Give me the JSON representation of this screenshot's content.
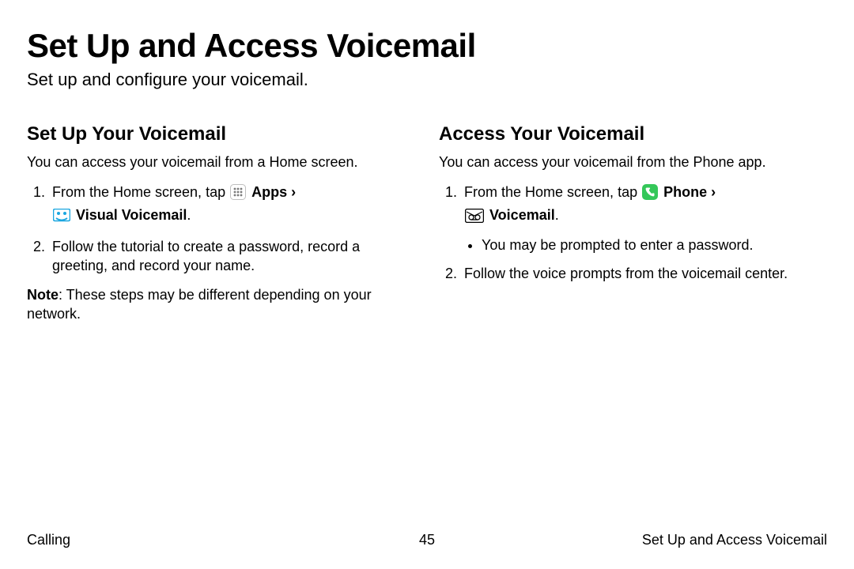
{
  "title": "Set Up and Access Voicemail",
  "subtitle": "Set up and configure your voicemail.",
  "left": {
    "heading": "Set Up Your Voicemail",
    "intro": "You can access your voicemail from a Home screen.",
    "step1_prefix": "From the Home screen, tap ",
    "apps_label": "Apps",
    "sep": "›",
    "visual_vm_label": "Visual Voicemail",
    "period": ".",
    "step2": "Follow the tutorial to create a password, record a greeting, and record your name.",
    "note_label": "Note",
    "note_body": ": These steps may be different depending on your network."
  },
  "right": {
    "heading": "Access Your Voicemail",
    "intro": "You can access your voicemail from the Phone app.",
    "step1_prefix": "From the Home screen, tap ",
    "phone_label": "Phone",
    "sep": "›",
    "vm_label": "Voicemail",
    "period": ".",
    "bullet1": "You may be prompted to enter a password.",
    "step2": "Follow the voice prompts from the voicemail center."
  },
  "footer": {
    "left": "Calling",
    "center": "45",
    "right": "Set Up and Access Voicemail"
  },
  "icons": {
    "apps": "apps-icon",
    "visual_vm": "visual-voicemail-icon",
    "phone": "phone-icon",
    "voicemail": "voicemail-icon"
  }
}
